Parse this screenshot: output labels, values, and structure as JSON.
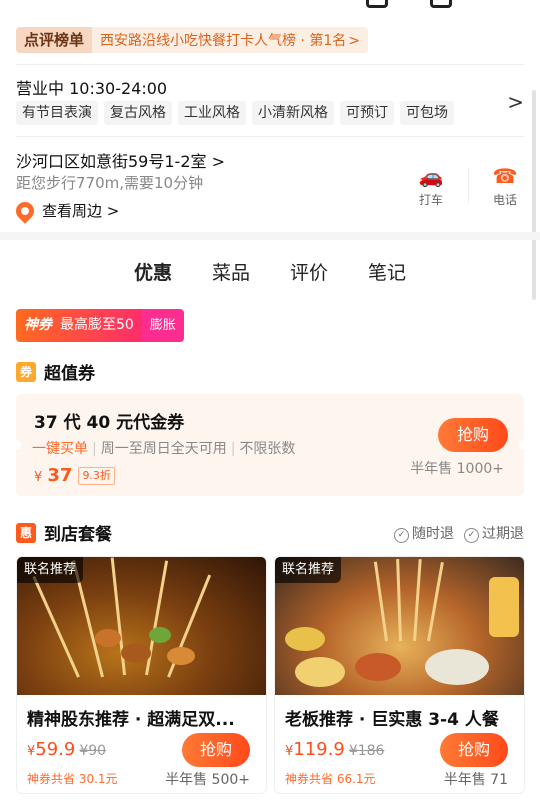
{
  "ranking": {
    "tag": "点评榜单",
    "text": "西安路沿线小吃快餐打卡人气榜 · 第1名",
    "chevron": ">"
  },
  "hours": {
    "label": "营业中 10:30-24:00",
    "tags": [
      "有节目表演",
      "复古风格",
      "工业风格",
      "小清新风格",
      "可预订",
      "可包场"
    ],
    "arrow": ">"
  },
  "address": {
    "text": "沙河口区如意街59号1-2室 >",
    "distance": "距您步行770m,需要10分钟",
    "nearby": "查看周边 >"
  },
  "actions": {
    "taxi_icon": "car-icon",
    "taxi_label": "打车",
    "phone_icon": "phone-icon",
    "phone_label": "电话"
  },
  "tabs": [
    {
      "label": "优惠",
      "active": true
    },
    {
      "label": "菜品",
      "active": false
    },
    {
      "label": "评价",
      "active": false
    },
    {
      "label": "笔记",
      "active": false
    }
  ],
  "shenquan": {
    "badge": "神券",
    "text": "最高膨至50",
    "side": "膨胀"
  },
  "value_coupon": {
    "icon_text": "券",
    "section_title": "超值券",
    "title": "37 代 40 元代金券",
    "one_click": "一键买单",
    "usage": "周一至周日全天可用",
    "limit": "不限张数",
    "yen": "¥",
    "price": "37",
    "discount": "9.3折",
    "buy_label": "抢购",
    "sold": "半年售 1000+"
  },
  "packages": {
    "icon_text": "惠",
    "section_title": "到店套餐",
    "refund_anytime": "随时退",
    "refund_expired": "过期退",
    "cards": [
      {
        "tag": "联名推荐",
        "title": "精神股东推荐 · 超满足双...",
        "yen": "¥",
        "price": "59.9",
        "old_price": "¥90",
        "buy_label": "抢购",
        "save": "神券共省 30.1元",
        "sold": "半年售 500+"
      },
      {
        "tag": "联名推荐",
        "title": "老板推荐 · 巨实惠 3-4 人餐",
        "yen": "¥",
        "price": "119.9",
        "old_price": "¥186",
        "buy_label": "抢购",
        "save": "神券共省 66.1元",
        "sold": "半年售 71"
      }
    ]
  },
  "colors": {
    "accent": "#ff5a1e",
    "brand_pink": "#ff2d8f"
  }
}
